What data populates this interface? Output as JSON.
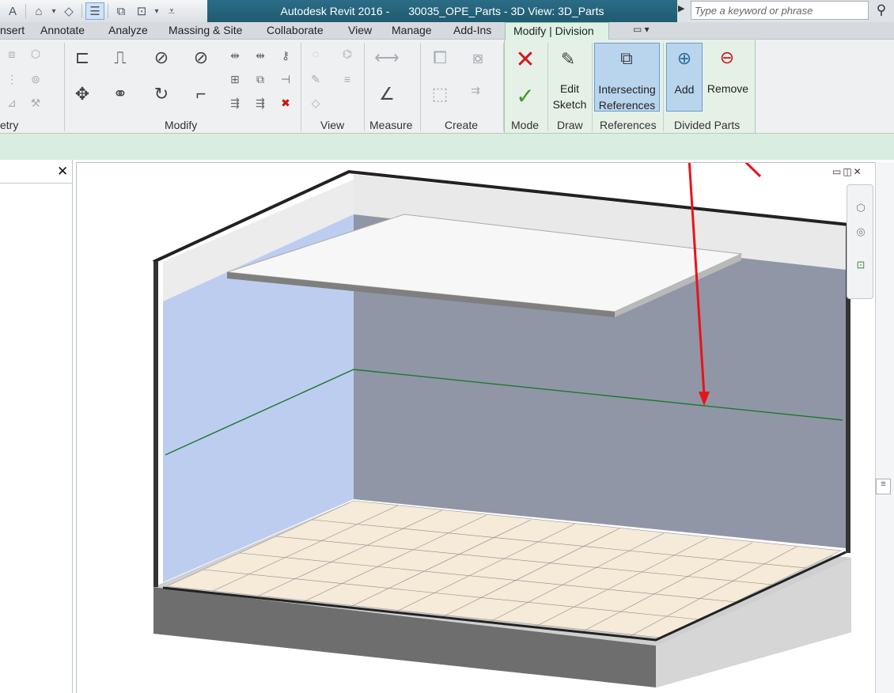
{
  "app": {
    "title_left": "Autodesk Revit 2016 -",
    "title_right": "30035_OPE_Parts - 3D View: 3D_Parts",
    "search_placeholder": "Type a keyword or phrase"
  },
  "tabs": [
    {
      "label": "nsert"
    },
    {
      "label": "Annotate"
    },
    {
      "label": "Analyze"
    },
    {
      "label": "Massing & Site"
    },
    {
      "label": "Collaborate"
    },
    {
      "label": "View"
    },
    {
      "label": "Manage"
    },
    {
      "label": "Add-Ins"
    },
    {
      "label": "Modify | Division",
      "active": true
    }
  ],
  "ribbon": {
    "panels": {
      "geometry": "etry",
      "modify": "Modify",
      "view": "View",
      "measure": "Measure",
      "create": "Create",
      "mode": "Mode",
      "draw": "Draw",
      "references": "References",
      "divided_parts": "Divided Parts"
    },
    "buttons": {
      "edit_sketch_1": "Edit",
      "edit_sketch_2": "Sketch",
      "intersecting_refs_1": "Intersecting",
      "intersecting_refs_2": "References",
      "add": "Add",
      "remove": "Remove"
    }
  },
  "colors": {
    "accent_active_tab": "#dff1e4",
    "title_bar": "#1f5a70",
    "selected_button": "#b9d5ee",
    "annotation_arrow": "#e8141a",
    "left_wall_part": "#bdcdf0",
    "back_wall": "#9096a6",
    "division_line": "#1a7a2a",
    "floor_tile": "#f6ead8"
  },
  "icons": [
    "text-icon",
    "home-icon",
    "binoculars-icon",
    "cancel-icon",
    "finish-icon",
    "edit-sketch-icon",
    "intersecting-references-icon",
    "add-parts-icon",
    "remove-parts-icon",
    "viewcube-icon",
    "steering-wheel-icon",
    "zoom-icon",
    "close-icon"
  ]
}
